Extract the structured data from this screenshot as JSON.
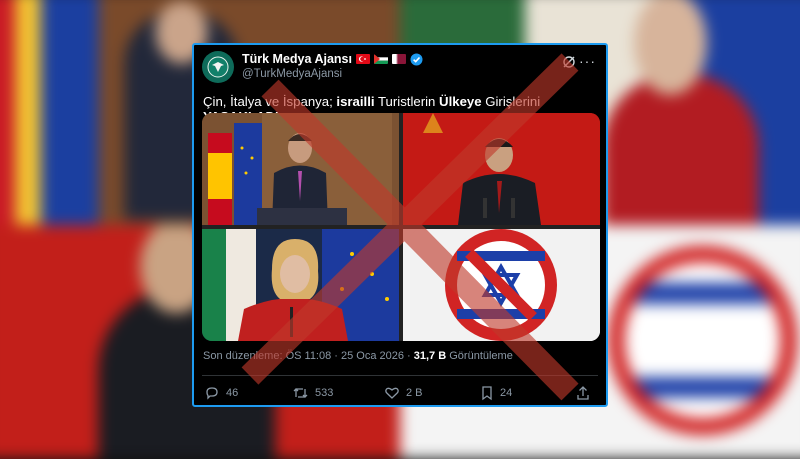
{
  "account": {
    "name": "Türk Medya Ajansı",
    "handle": "@TurkMedyaAjansi",
    "flags": [
      "turkey-flag-icon",
      "palestine-flag-icon",
      "qatar-flag-icon"
    ],
    "verified": true
  },
  "tweet": {
    "text_part1": "Çin, İtalya ve İspanya; ",
    "text_bold1": "israilli",
    "text_part2": " Turistlerin ",
    "text_bold2": "Ülkeye",
    "text_part3": " Girişlerini ",
    "text_bold3": "YASAKLADI."
  },
  "meta": {
    "edited_label": "Son düzenleme:",
    "time": "ÖS 11:08 · 25 Oca 2026 · ",
    "views": "31,7 B",
    "views_label": " Görüntüleme"
  },
  "actions": {
    "replies": "46",
    "reposts": "533",
    "likes": "2 B",
    "bookmarks": "24"
  },
  "colors": {
    "accent": "#1d9bf0",
    "cross": "#c0392b",
    "ban_red": "#d12424",
    "israel_blue": "#1c3fa8"
  }
}
